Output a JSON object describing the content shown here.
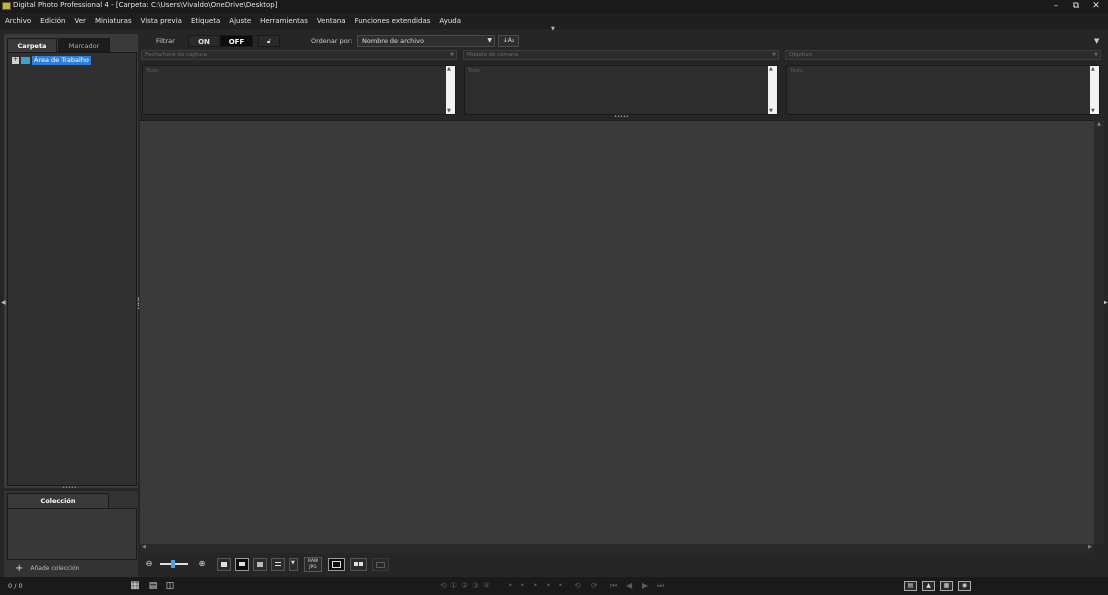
{
  "window": {
    "title": "Digital Photo Professional 4 - [Carpeta: C:\\Users\\Vivaldo\\OneDrive\\Desktop]",
    "controls": [
      "minimize",
      "restore",
      "close"
    ]
  },
  "menubar": {
    "items": [
      "Archivo",
      "Edición",
      "Ver",
      "Miniaturas",
      "Vista previa",
      "Etiqueta",
      "Ajuste",
      "Herramientas",
      "Ventana",
      "Funciones extendidas",
      "Ayuda"
    ]
  },
  "left_panel": {
    "tabs": [
      {
        "label": "Carpeta",
        "active": true
      },
      {
        "label": "Marcador",
        "active": false
      }
    ],
    "tree": [
      {
        "label": "Área de Trabalho",
        "expanded": false,
        "selected": true
      }
    ]
  },
  "collection_panel": {
    "tab_label": "Colección",
    "add_label": "Añade colección"
  },
  "filter_bar": {
    "filter_label": "Filtrar",
    "on_label": "ON",
    "off_label": "OFF",
    "active_state": "OFF",
    "sort_label": "Ordenar por:",
    "sort_value": "Nombre de archivo",
    "sort_order_label": "↓A₂"
  },
  "filter_columns": [
    {
      "select_label": "Fecha/hora de captura",
      "list_item": "Todo"
    },
    {
      "select_label": "Modelo de cámara",
      "list_item": "Todo"
    },
    {
      "select_label": "Objetivo",
      "list_item": "Todo"
    }
  ],
  "status": {
    "count": "0 / 0"
  },
  "bottom_toolbar": {
    "raw_label_top": "RAW",
    "raw_label_bottom": "JPG"
  },
  "icons": {
    "app": "dpp-app-icon",
    "zoom_out": "zoom-out-icon",
    "zoom_in": "zoom-in-icon",
    "add": "plus-icon"
  },
  "colors": {
    "selection": "#2f7fd8",
    "zoom_knob": "#4aa0e0"
  }
}
